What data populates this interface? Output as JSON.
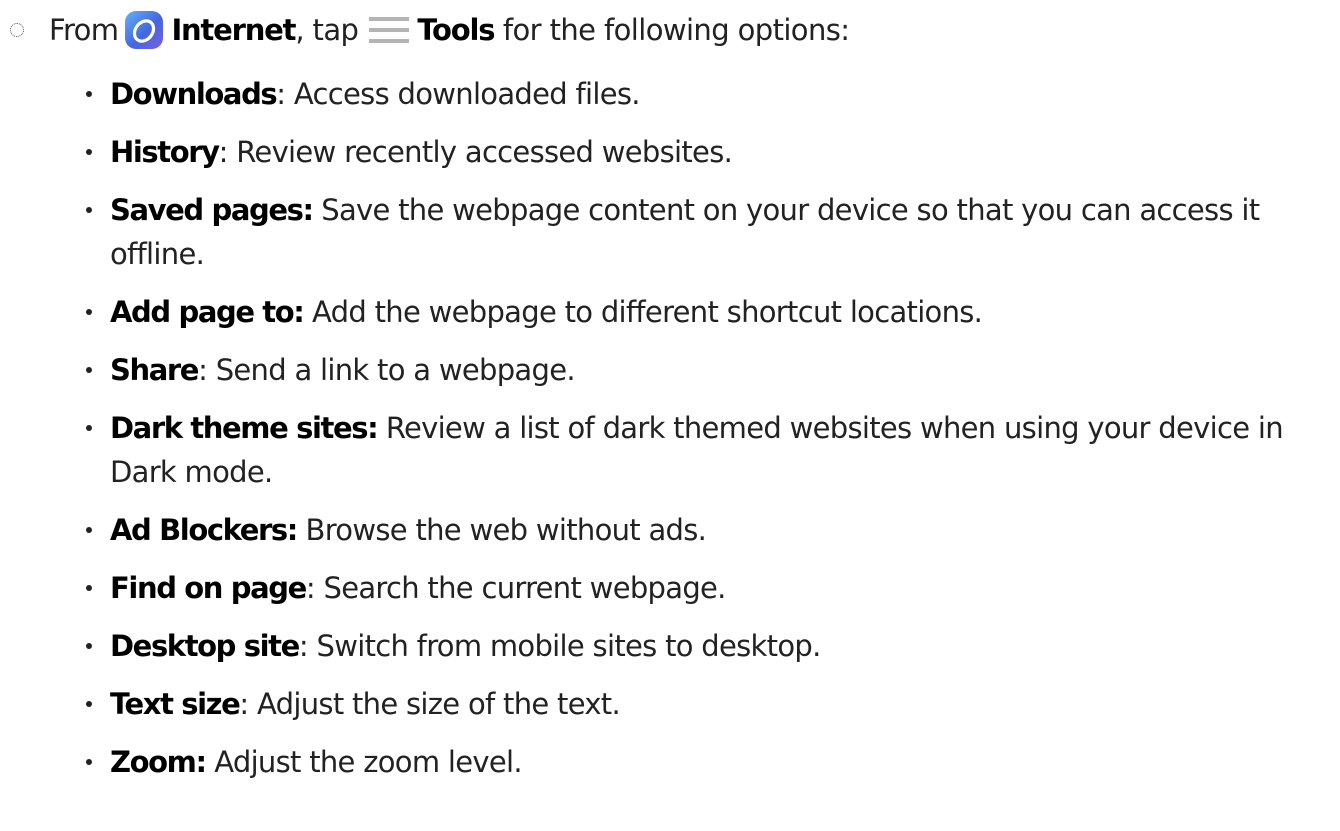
{
  "intro": {
    "from": "From",
    "app_name": "Internet",
    "comma_tap": ", tap",
    "tools_label": "Tools",
    "rest": "for the following options:",
    "app_icon": "samsung-internet-icon",
    "tools_icon": "hamburger-menu-icon",
    "app_icon_colors": [
      "#5fa4f7",
      "#3b5bdb",
      "#7b5fe0"
    ]
  },
  "options": [
    {
      "term": "Downloads",
      "desc": "Access downloaded files."
    },
    {
      "term": "History",
      "desc": "Review recently accessed websites."
    },
    {
      "term": "Saved pages:",
      "desc": "Save the webpage content on your device so that you can access it offline."
    },
    {
      "term": "Add page to:",
      "desc": "Add the webpage to different shortcut locations."
    },
    {
      "term": "Share",
      "desc": "Send a link to a webpage."
    },
    {
      "term": "Dark theme sites:",
      "desc": "Review a list of dark themed websites when using your device in Dark mode."
    },
    {
      "term": "Ad Blockers:",
      "desc": "Browse the web without ads."
    },
    {
      "term": "Find on page",
      "desc": "Search the current webpage."
    },
    {
      "term": "Desktop site",
      "desc": "Switch from mobile sites to desktop."
    },
    {
      "term": "Text size",
      "desc": "Adjust the size of the text."
    },
    {
      "term": "Zoom:",
      "desc": "Adjust the zoom level."
    }
  ],
  "separators": [
    ":",
    ":",
    "",
    "",
    ":",
    "",
    "",
    ":",
    ":",
    ":",
    ""
  ]
}
